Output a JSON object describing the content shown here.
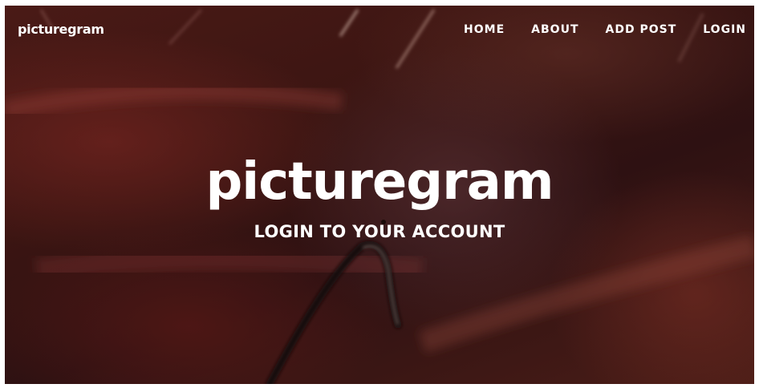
{
  "brand": "picturegram",
  "nav": {
    "home": "HOME",
    "about": "ABOUT",
    "add_post": "ADD POST",
    "login": "LOGIN"
  },
  "hero": {
    "title": "picturegram",
    "subtitle": "LOGIN TO YOUR ACCOUNT"
  },
  "colors": {
    "text": "#ffffff",
    "background": "#3a1512"
  }
}
